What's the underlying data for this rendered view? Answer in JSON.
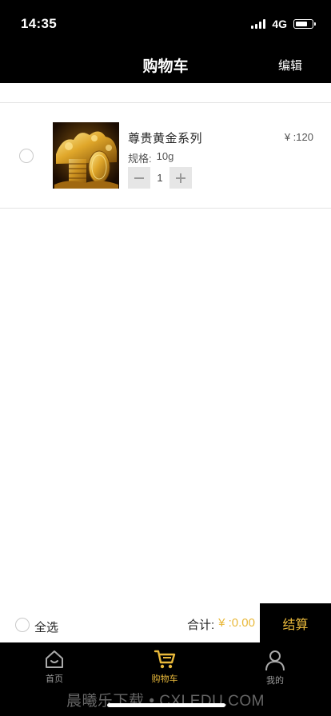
{
  "status_bar": {
    "time": "14:35",
    "network": "4G",
    "battery_level": 0.72
  },
  "nav": {
    "title": "购物车",
    "edit_label": "编辑"
  },
  "cart": {
    "items": [
      {
        "name": "尊贵黄金系列",
        "price": "¥ :120",
        "spec_label": "规格:",
        "spec_value": "10g",
        "quantity": "1",
        "selected": false
      }
    ]
  },
  "footer": {
    "select_all_label": "全选",
    "total_label": "合计:",
    "total_value": "¥ :0.00",
    "checkout_label": "结算"
  },
  "tabbar": {
    "items": [
      {
        "label": "首页",
        "icon": "home-icon",
        "active": false
      },
      {
        "label": "购物车",
        "icon": "cart-icon",
        "active": true
      },
      {
        "label": "我的",
        "icon": "user-icon",
        "active": false
      }
    ]
  },
  "watermark": "晨曦乐下载 • CXLEDU.COM",
  "colors": {
    "accent": "#e9b93b",
    "bar_background": "#000000",
    "stepper_background": "#e6e6e6"
  }
}
